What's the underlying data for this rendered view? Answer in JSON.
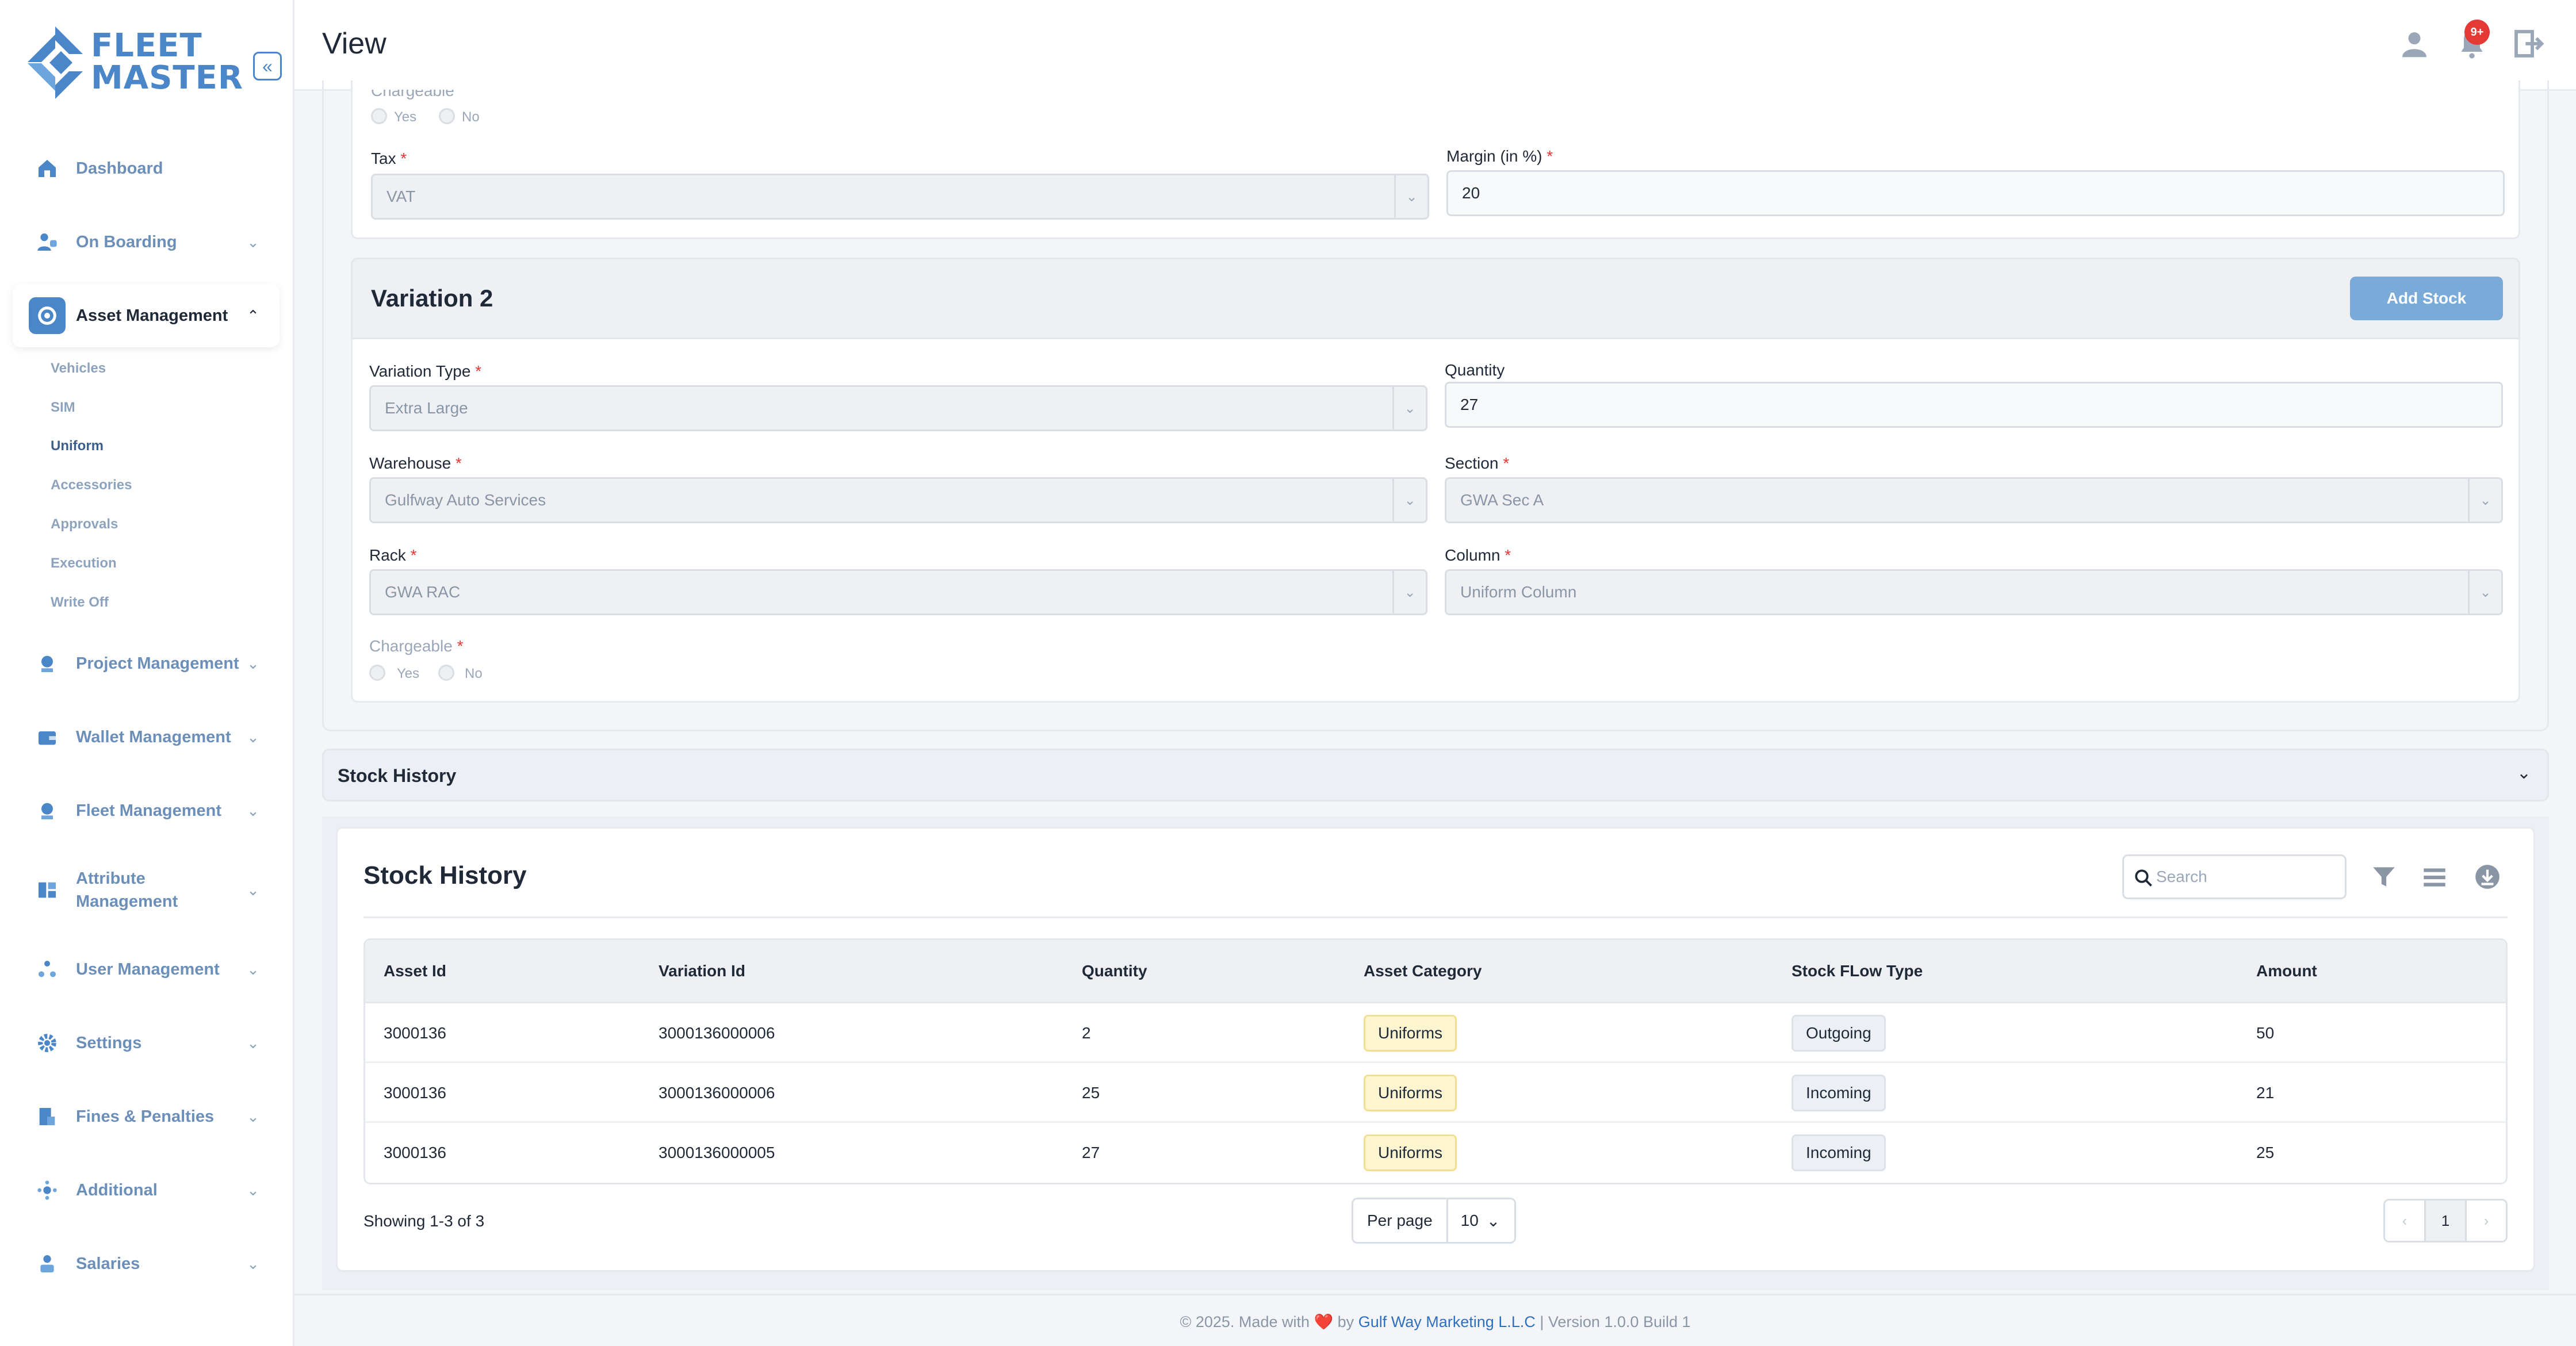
{
  "brand": {
    "logo_text": "FLEET\nMASTER",
    "color": "#4a86c8"
  },
  "header": {
    "title": "View",
    "notification_count": "9+"
  },
  "sidebar": {
    "collapse_icon": "«",
    "items": [
      {
        "label": "Dashboard",
        "icon": "home-icon"
      },
      {
        "label": "On Boarding",
        "icon": "onboarding-icon"
      },
      {
        "label": "Asset Management",
        "icon": "asset-icon",
        "active": true
      },
      {
        "label": "Project Management",
        "icon": "project-icon"
      },
      {
        "label": "Wallet Management",
        "icon": "wallet-icon"
      },
      {
        "label": "Fleet Management",
        "icon": "fleet-icon"
      },
      {
        "label": "Attribute Management",
        "icon": "attribute-icon"
      },
      {
        "label": "User Management",
        "icon": "users-icon"
      },
      {
        "label": "Settings",
        "icon": "gear-icon"
      },
      {
        "label": "Fines & Penalties",
        "icon": "fines-icon"
      },
      {
        "label": "Additional",
        "icon": "additional-icon"
      },
      {
        "label": "Salaries",
        "icon": "salaries-icon"
      }
    ],
    "sub_items": [
      "Vehicles",
      "SIM",
      "Uniform",
      "Accessories",
      "Approvals",
      "Execution",
      "Write Off"
    ],
    "active_sub": "Uniform"
  },
  "variation1": {
    "chargeable_label": "Chargeable",
    "yes": "Yes",
    "no": "No",
    "tax_label": "Tax",
    "tax_value": "VAT",
    "margin_label": "Margin (in %)",
    "margin_value": "20"
  },
  "variation2": {
    "title": "Variation 2",
    "add_stock": "Add Stock",
    "variation_type_label": "Variation Type",
    "variation_type_value": "Extra Large",
    "quantity_label": "Quantity",
    "quantity_value": "27",
    "warehouse_label": "Warehouse",
    "warehouse_value": "Gulfway Auto Services",
    "section_label": "Section",
    "section_value": "GWA Sec A",
    "rack_label": "Rack",
    "rack_value": "GWA RAC",
    "column_label": "Column",
    "column_value": "Uniform Column",
    "chargeable_label": "Chargeable",
    "yes": "Yes",
    "no": "No"
  },
  "required_mark": "*",
  "accordion": {
    "title": "Stock History"
  },
  "stock_history": {
    "title": "Stock History",
    "search_placeholder": "Search",
    "columns": [
      "Asset Id",
      "Variation Id",
      "Quantity",
      "Asset Category",
      "Stock FLow Type",
      "Amount"
    ],
    "rows": [
      {
        "asset_id": "3000136",
        "variation_id": "3000136000006",
        "quantity": "2",
        "category": "Uniforms",
        "flow": "Outgoing",
        "amount": "50"
      },
      {
        "asset_id": "3000136",
        "variation_id": "3000136000006",
        "quantity": "25",
        "category": "Uniforms",
        "flow": "Incoming",
        "amount": "21"
      },
      {
        "asset_id": "3000136",
        "variation_id": "3000136000005",
        "quantity": "27",
        "category": "Uniforms",
        "flow": "Incoming",
        "amount": "25"
      }
    ],
    "showing": "Showing 1-3 of 3",
    "per_page_label": "Per page",
    "per_page_value": "10",
    "current_page": "1"
  },
  "footer": {
    "prefix": "© 2025. Made with",
    "heart": "❤️",
    "by": "by",
    "company": "Gulf Way Marketing L.L.C",
    "version": "| Version 1.0.0 Build 1"
  }
}
